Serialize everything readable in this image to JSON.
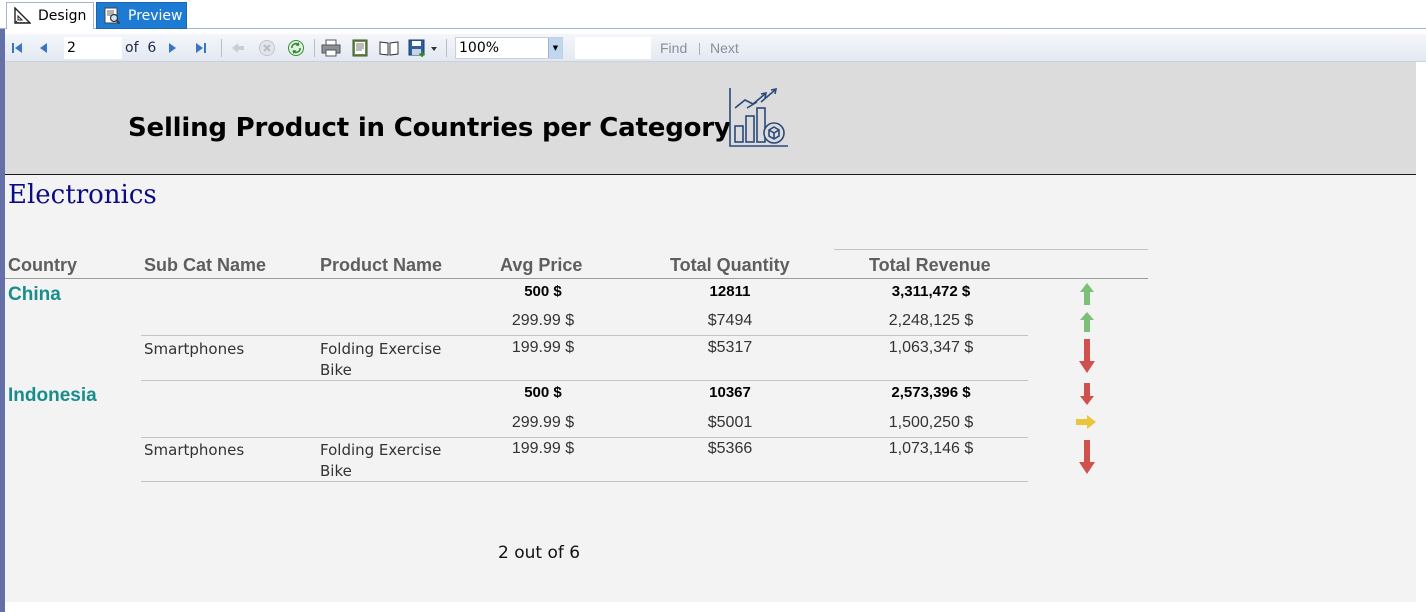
{
  "tabs": {
    "design_label": "Design",
    "preview_label": "Preview"
  },
  "toolbar": {
    "current_page": "2",
    "of_label": "of",
    "total_pages": "6",
    "zoom": "100%",
    "find_label": "Find",
    "next_label": "Next",
    "separator": "|"
  },
  "report": {
    "title": "Selling Product in Countries per Category",
    "category": "Electronics",
    "columns": {
      "country": "Country",
      "sub_cat": "Sub Cat Name",
      "product": "Product Name",
      "avg_price": "Avg Price",
      "total_qty": "Total Quantity",
      "total_revenue": "Total Revenue"
    },
    "groups": [
      {
        "country": "China",
        "summary": {
          "avg_price": "500 $",
          "total_qty": "12811",
          "total_revenue": "3,311,472 $",
          "trend": "up"
        },
        "row1": {
          "avg_price": "299.99 $",
          "total_qty": "$7494",
          "total_revenue": "2,248,125 $",
          "trend": "up"
        },
        "row2": {
          "sub_cat": "Smartphones",
          "product_line1": "Folding Exercise",
          "product_line2": "Bike",
          "avg_price": "199.99 $",
          "total_qty": "$5317",
          "total_revenue": "1,063,347 $",
          "trend": "down"
        }
      },
      {
        "country": "Indonesia",
        "summary": {
          "avg_price": "500 $",
          "total_qty": "10367",
          "total_revenue": "2,573,396 $",
          "trend": "down"
        },
        "row1": {
          "avg_price": "299.99 $",
          "total_qty": "$5001",
          "total_revenue": "1,500,250 $",
          "trend": "neutral"
        },
        "row2": {
          "sub_cat": "Smartphones",
          "product_line1": "Folding Exercise",
          "product_line2": "Bike",
          "avg_price": "199.99 $",
          "total_qty": "$5366",
          "total_revenue": "1,073,146 $",
          "trend": "down"
        }
      }
    ],
    "page_footer": "2 out of 6"
  },
  "colors": {
    "up": "#7cbf76",
    "down": "#d0504d",
    "neutral": "#eac53c",
    "country": "#1a8c8c",
    "category": "#0b0b84",
    "tab_active": "#1e7bd4"
  },
  "icons": {
    "design_tab": "ruler-triangle-icon",
    "preview_tab": "preview-icon",
    "first": "first-page-icon",
    "prev": "previous-page-icon",
    "next": "next-page-icon",
    "last": "last-page-icon",
    "back": "back-icon",
    "stop": "stop-icon",
    "refresh": "refresh-icon",
    "print": "print-icon",
    "print_layout": "print-layout-icon",
    "page_setup": "page-setup-icon",
    "export": "export-save-icon",
    "logo": "growth-chart-logo"
  }
}
